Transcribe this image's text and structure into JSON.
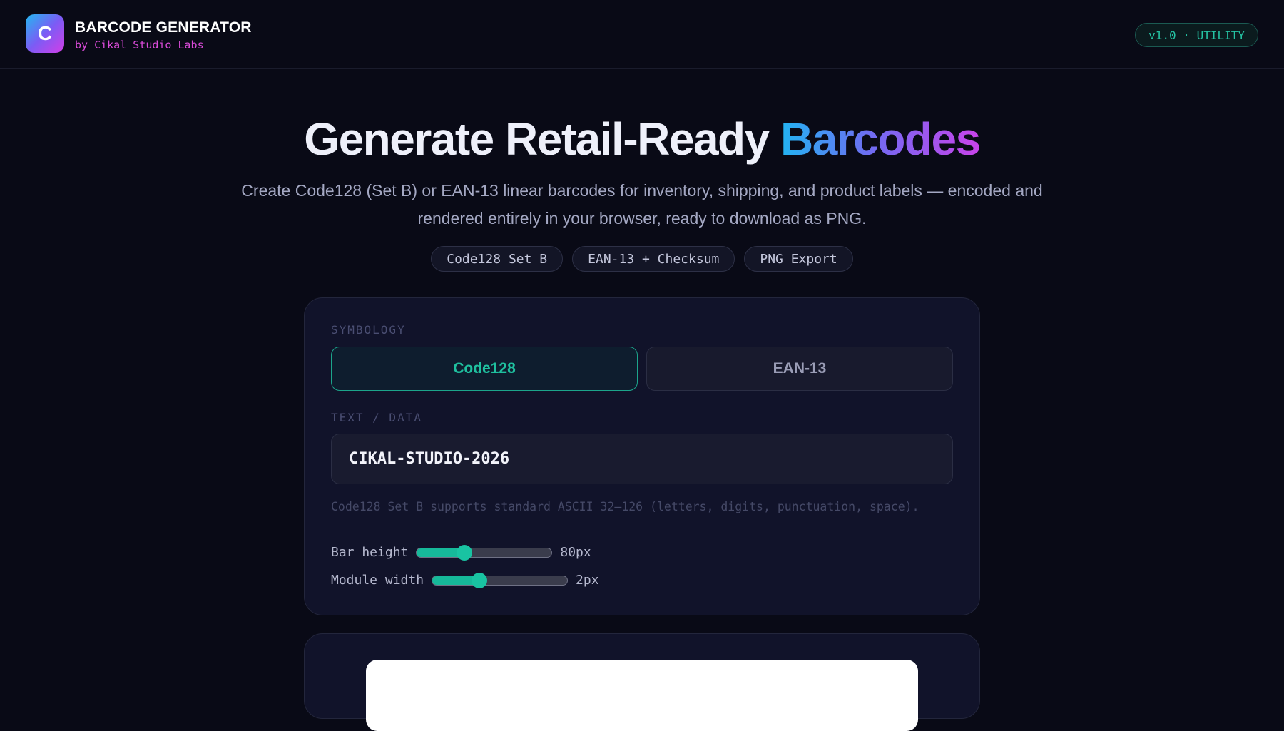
{
  "header": {
    "logo_letter": "C",
    "title": "BARCODE GENERATOR",
    "subtitle": "by Cikal Studio Labs",
    "version": "v1.0 · UTILITY"
  },
  "hero": {
    "title_main": "Generate Retail-Ready ",
    "title_highlight": "Barcodes",
    "description": "Create Code128 (Set B) or EAN-13 linear barcodes for inventory, shipping, and product labels — encoded and rendered entirely in your browser, ready to download as PNG.",
    "chips": [
      "Code128 Set B",
      "EAN-13 + Checksum",
      "PNG Export"
    ]
  },
  "form": {
    "symbology_label": "SYMBOLOGY",
    "symbology_options": [
      "Code128",
      "EAN-13"
    ],
    "symbology_selected": "Code128",
    "text_label": "TEXT / DATA",
    "text_value": "CIKAL-STUDIO-2026",
    "hint": "Code128 Set B supports standard ASCII 32–126 (letters, digits, punctuation, space).",
    "bar_height": {
      "label": "Bar height",
      "value": "80px",
      "fraction": 0.35
    },
    "module_width": {
      "label": "Module width",
      "value": "2px",
      "fraction": 0.35
    }
  },
  "colors": {
    "accent": "#1fc09f",
    "brand_gradient_start": "#22b4f2",
    "brand_gradient_end": "#c943ea",
    "background": "#090a16"
  }
}
